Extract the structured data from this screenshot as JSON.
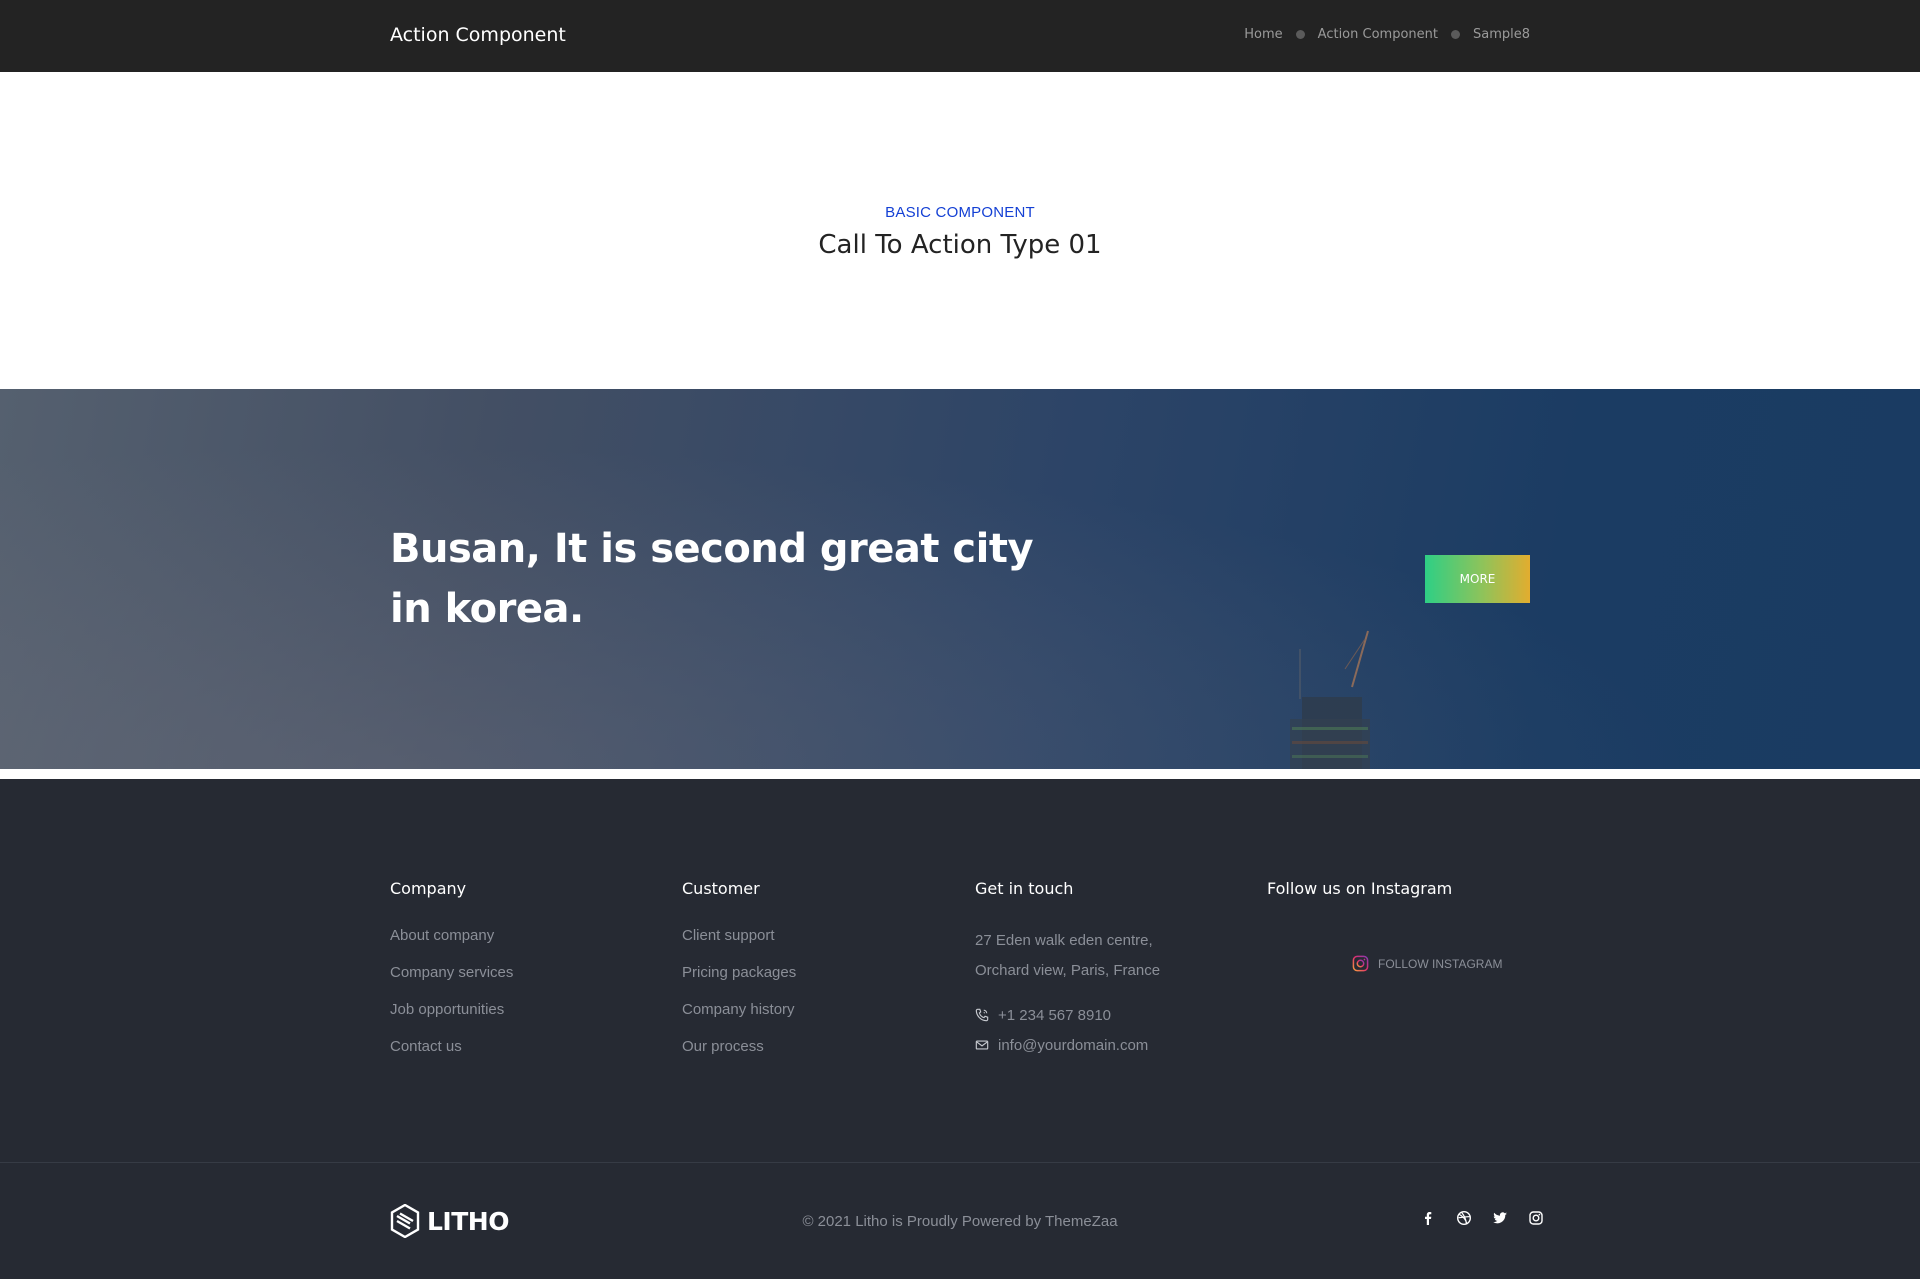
{
  "header": {
    "title": "Action Component",
    "breadcrumb": [
      "Home",
      "Action Component",
      "Sample8"
    ]
  },
  "intro": {
    "eyebrow": "BASIC COMPONENT",
    "title": "Call To Action Type 01"
  },
  "cta": {
    "headline": "Busan, It is second great city in korea.",
    "button_label": "MORE"
  },
  "footer": {
    "company": {
      "heading": "Company",
      "links": [
        "About company",
        "Company services",
        "Job opportunities",
        "Contact us"
      ]
    },
    "customer": {
      "heading": "Customer",
      "links": [
        "Client support",
        "Pricing packages",
        "Company history",
        "Our process"
      ]
    },
    "touch": {
      "heading": "Get in touch",
      "address_line1": "27 Eden walk eden centre,",
      "address_line2": "Orchard view, Paris, France",
      "phone": "+1 234 567 8910",
      "email": "info@yourdomain.com"
    },
    "instagram": {
      "heading": "Follow us on Instagram",
      "follow_label": "FOLLOW INSTAGRAM"
    },
    "logo_text": "LITHO",
    "copyright": "© 2021 Litho is Proudly Powered by ThemeZaa",
    "social_icons": [
      "facebook-icon",
      "dribbble-icon",
      "twitter-icon",
      "instagram-icon"
    ]
  },
  "colors": {
    "topbar": "#232323",
    "accent_blue": "#1440d4",
    "footer_bg": "#262a33",
    "button_gradient_start": "#2ecf85",
    "button_gradient_end": "#e2ad2f"
  }
}
